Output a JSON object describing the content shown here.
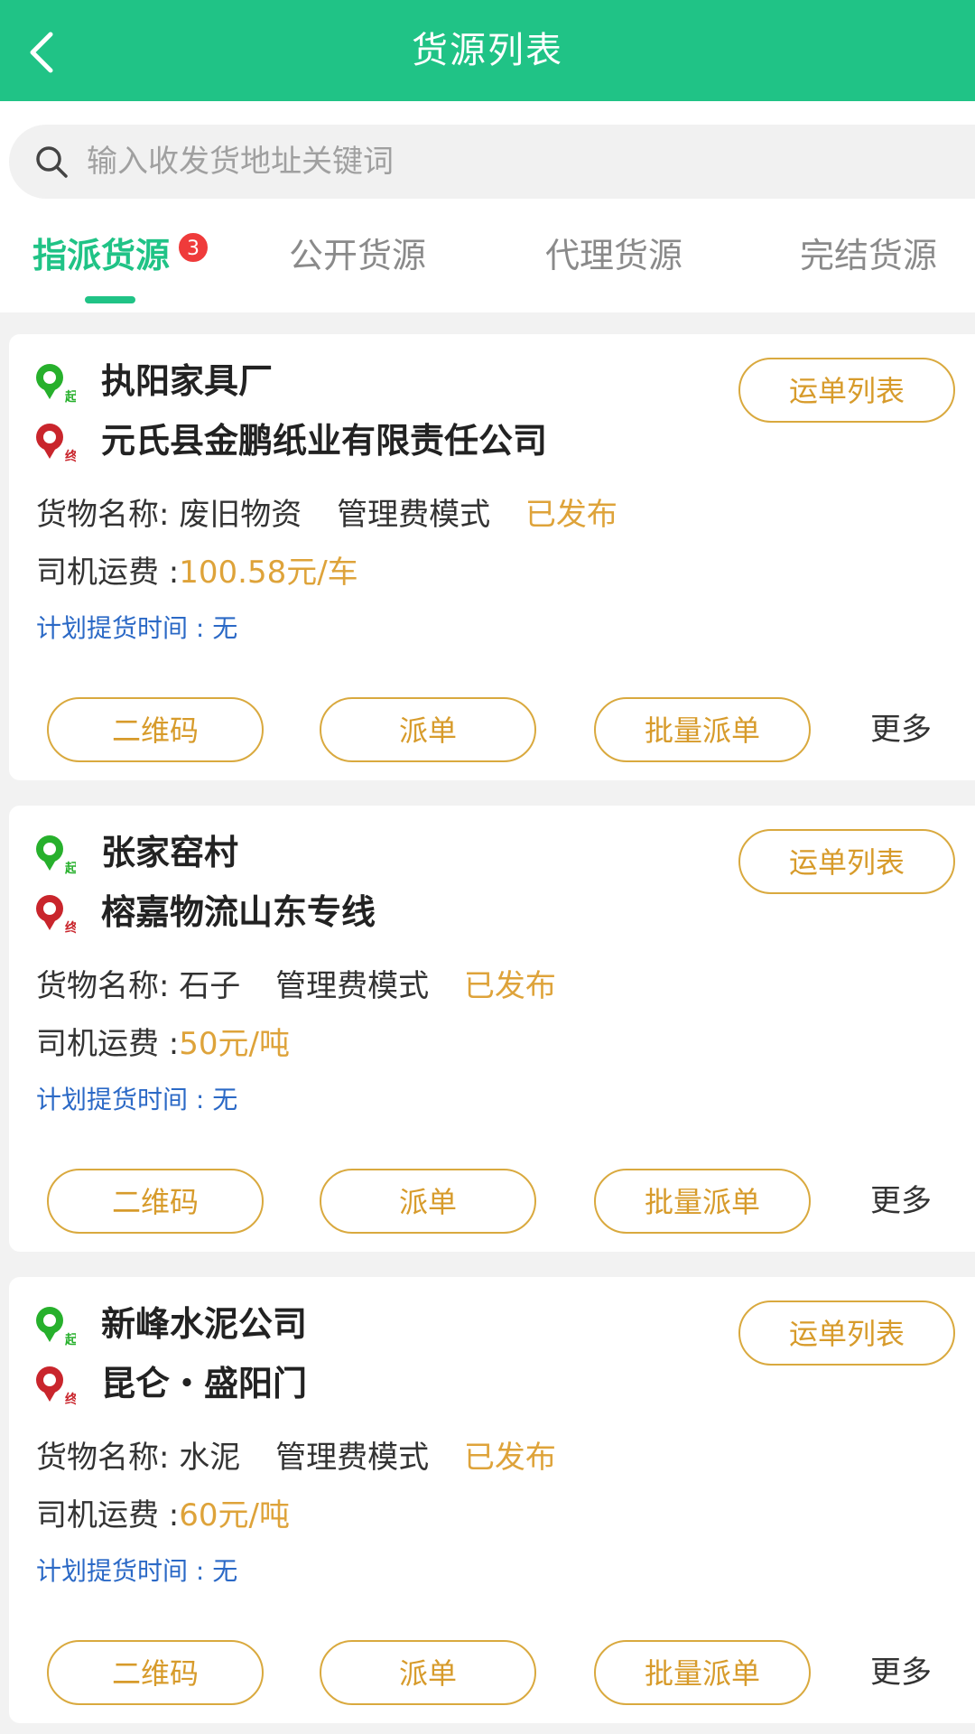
{
  "header": {
    "title": "货源列表"
  },
  "search": {
    "placeholder": "输入收发货地址关键词"
  },
  "tabs": [
    {
      "label": "指派货源",
      "active": true,
      "badge": "3"
    },
    {
      "label": "公开货源",
      "active": false
    },
    {
      "label": "代理货源",
      "active": false
    },
    {
      "label": "完结货源",
      "active": false
    }
  ],
  "labels": {
    "start_tag": "起",
    "end_tag": "终",
    "goods_label": "货物名称:",
    "fee_label": "司机运费 :",
    "plan_label": "计划提货时间 : ",
    "waybill_list": "运单列表",
    "qr_code": "二维码",
    "dispatch": "派单",
    "batch_dispatch": "批量派单",
    "more": "更多"
  },
  "colors": {
    "brand_green": "#20c386",
    "accent_gold": "#dea33a",
    "link_blue": "#2b69c6",
    "badge_red": "#ef3b3b",
    "start_pin": "#27b02c",
    "end_pin": "#c9252c"
  },
  "cards": [
    {
      "from": "执阳家具厂",
      "to": "元氏县金鹏纸业有限责任公司",
      "goods": "废旧物资",
      "mode": "管理费模式",
      "status": "已发布",
      "fee": "100.58元/车",
      "plan_time": "无"
    },
    {
      "from": "张家窑村",
      "to": "榕嘉物流山东专线",
      "goods": "石子",
      "mode": "管理费模式",
      "status": "已发布",
      "fee": "50元/吨",
      "plan_time": "无"
    },
    {
      "from": "新峰水泥公司",
      "to": "昆仑・盛阳门",
      "goods": "水泥",
      "mode": "管理费模式",
      "status": "已发布",
      "fee": "60元/吨",
      "plan_time": "无"
    }
  ]
}
